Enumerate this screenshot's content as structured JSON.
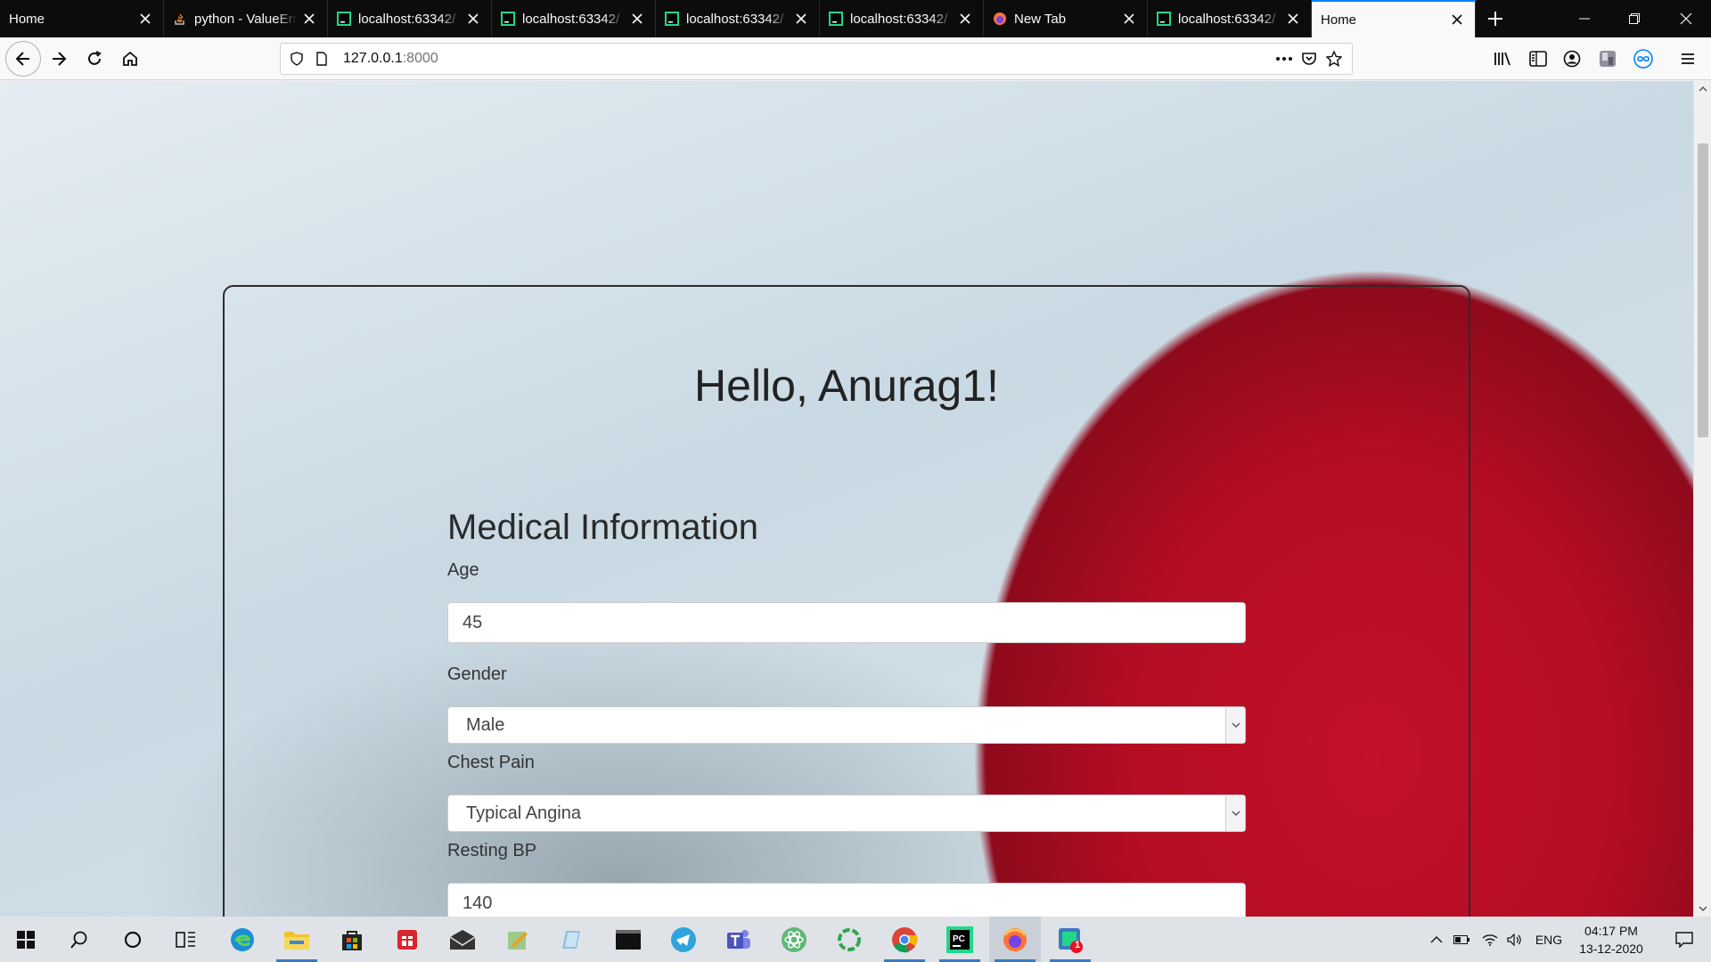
{
  "browser": {
    "tabs": [
      {
        "title": "Home",
        "favicon": "none",
        "active": false
      },
      {
        "title": "python - ValueError",
        "favicon": "stackoverflow-icon",
        "active": false
      },
      {
        "title": "localhost:63342/",
        "favicon": "pycharm-icon",
        "active": false
      },
      {
        "title": "localhost:63342/",
        "favicon": "pycharm-icon",
        "active": false
      },
      {
        "title": "localhost:63342/",
        "favicon": "pycharm-icon",
        "active": false
      },
      {
        "title": "localhost:63342/",
        "favicon": "pycharm-icon",
        "active": false
      },
      {
        "title": "New Tab",
        "favicon": "firefox-icon",
        "active": false
      },
      {
        "title": "localhost:63342/",
        "favicon": "pycharm-icon",
        "active": false
      },
      {
        "title": "Home",
        "favicon": "none",
        "active": true
      }
    ],
    "url_host": "127.0.0.1",
    "url_port": ":8000",
    "accent": "#0a84ff"
  },
  "page": {
    "greeting": "Hello, Anurag1!",
    "section_title": "Medical Information",
    "fields": {
      "age": {
        "label": "Age",
        "value": "45"
      },
      "gender": {
        "label": "Gender",
        "value": "Male"
      },
      "chest_pain": {
        "label": "Chest Pain",
        "value": "Typical Angina"
      },
      "resting_bp": {
        "label": "Resting BP",
        "value": "140"
      }
    }
  },
  "taskbar": {
    "apps": [
      "windows-start-icon",
      "search-icon",
      "cortana-icon",
      "task-view-icon",
      "edge-icon",
      "file-explorer-icon",
      "store-icon",
      "gift-icon",
      "mail-icon",
      "notepad-icon",
      "paint-icon",
      "terminal-icon",
      "telegram-icon",
      "teams-icon",
      "atom-icon",
      "refresh-app-icon",
      "chrome-icon",
      "pycharm-icon",
      "firefox-icon",
      "badge-app-icon"
    ],
    "badge_count": "1",
    "language": "ENG",
    "time": "04:17 PM",
    "date": "13-12-2020"
  }
}
